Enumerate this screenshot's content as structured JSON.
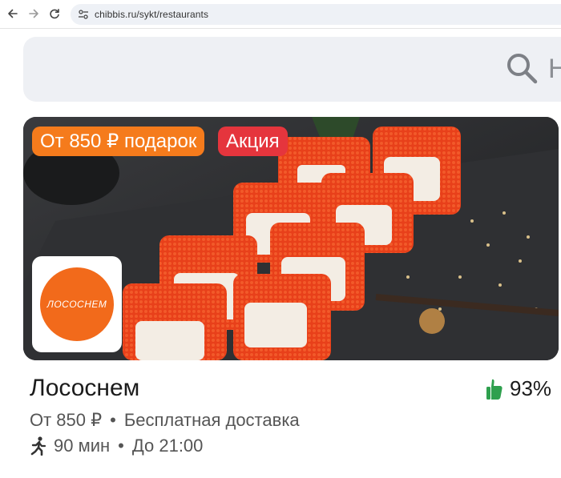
{
  "browser": {
    "url": "chibbis.ru/sykt/restaurants",
    "icons": [
      "back-arrow-icon",
      "forward-arrow-icon",
      "reload-icon",
      "site-settings-icon"
    ]
  },
  "search": {
    "placeholder_fragment": "Н",
    "icon": "search-icon"
  },
  "banner": {
    "gift_badge": "От 850 ₽ подарок",
    "promo_badge": "Акция",
    "logo_text": "ЛОСОСНЕМ",
    "colors": {
      "gift": "#f57b1c",
      "promo": "#e5353d",
      "logo": "#f26a1b"
    }
  },
  "restaurant": {
    "name": "Лососнем",
    "rating": "93%",
    "rating_icon": "thumbs-up-icon",
    "min_order": "От 850 ₽",
    "delivery": "Бесплатная доставка",
    "delivery_time": "90 мин",
    "hours": "До 21:00",
    "time_icon": "walking-person-icon",
    "rating_color": "#2fa04e"
  }
}
